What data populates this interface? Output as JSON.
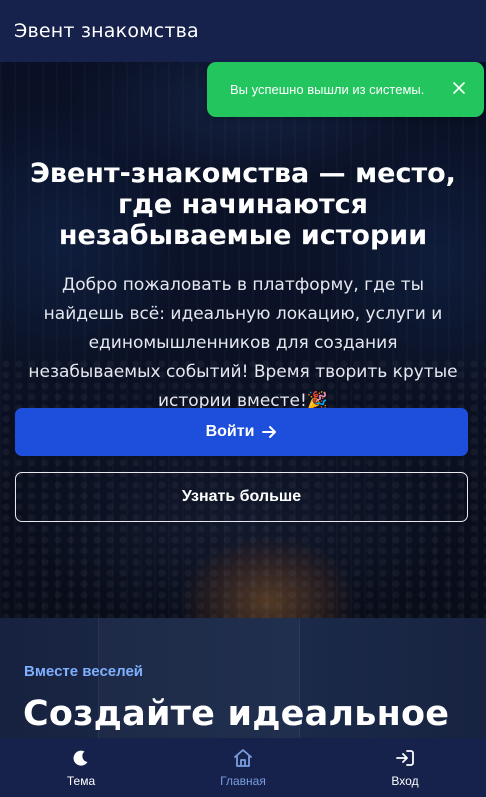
{
  "header": {
    "title": "Эвент знакомства"
  },
  "toast": {
    "message": "Вы успешно вышли из системы.",
    "close_icon": "close-icon",
    "color": "#22c55e"
  },
  "hero": {
    "title": "Эвент-знакомства — место, где начинаются незабываемые истории",
    "subtitle": "Добро пожаловать в платформу, где ты найдешь всё: идеальную локацию, услуги и единомышленников для создания незабываемых событий! Время творить крутые истории вместе!🎉",
    "login_button": "Войти",
    "login_icon": "arrow-right-icon",
    "more_button": "Узнать больше"
  },
  "section": {
    "kicker": "Вместе веселей",
    "heading": "Создайте идеальное"
  },
  "bottom_nav": {
    "items": [
      {
        "label": "Тема",
        "icon": "moon-icon",
        "active": false
      },
      {
        "label": "Главная",
        "icon": "home-icon",
        "active": true
      },
      {
        "label": "Вход",
        "icon": "login-icon",
        "active": false
      }
    ]
  },
  "colors": {
    "primary": "#1e4fdc",
    "header_bg": "#16224c",
    "accent_text": "#7fb0ff",
    "nav_active": "#7a9fe0"
  }
}
